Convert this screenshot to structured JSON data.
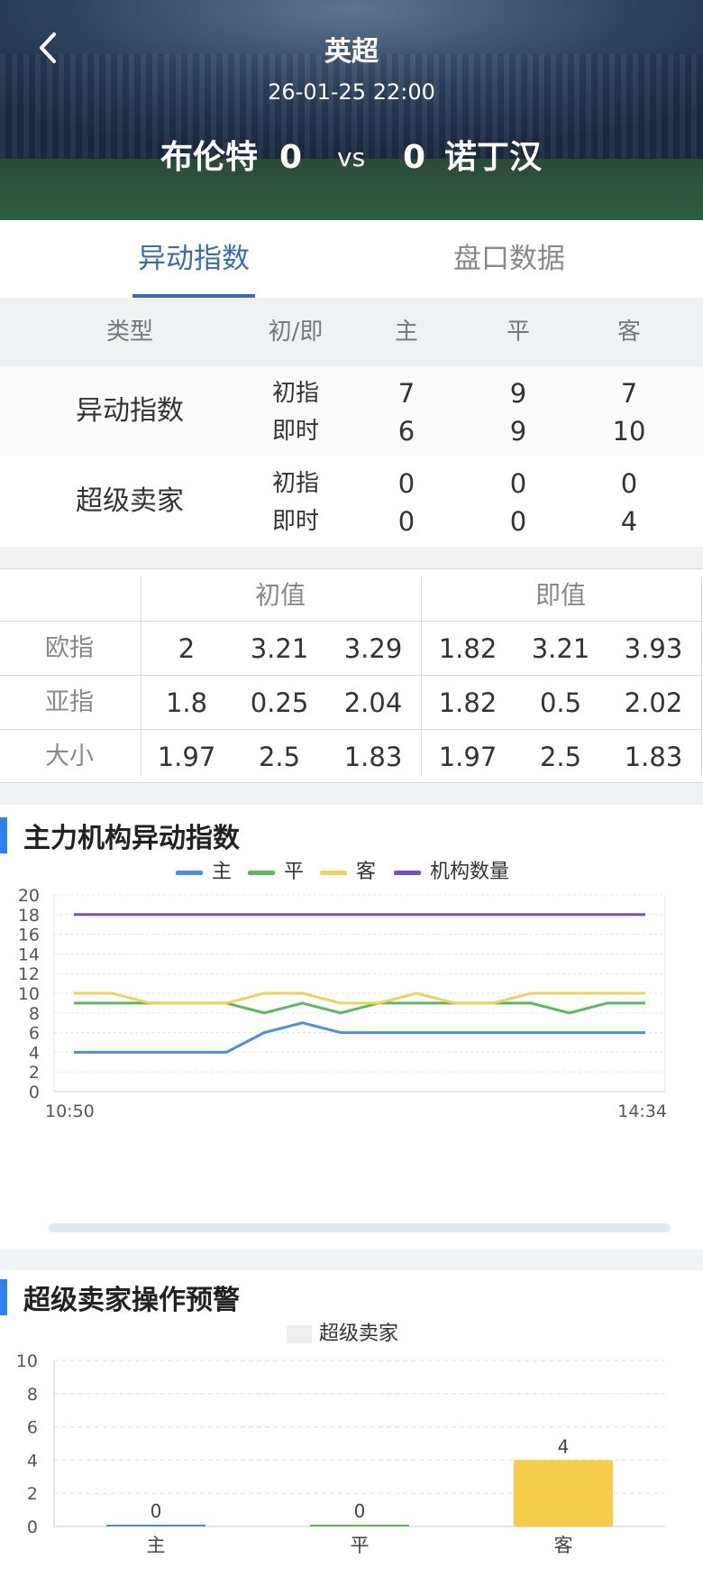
{
  "header": {
    "league": "英超",
    "datetime": "26-01-25 22:00",
    "home_team": "布伦特",
    "home_score": "0",
    "vs": "vs",
    "away_score": "0",
    "away_team": "诺丁汉",
    "back_icon": "chevron-left-icon"
  },
  "tabs": [
    {
      "label": "异动指数",
      "active": true
    },
    {
      "label": "盘口数据",
      "active": false
    }
  ],
  "anomaly_table": {
    "headers": [
      "类型",
      "初/即",
      "主",
      "平",
      "客"
    ],
    "rows": [
      {
        "name": "异动指数",
        "lines": [
          {
            "label": "初指",
            "values": [
              "7",
              "9",
              "7"
            ]
          },
          {
            "label": "即时",
            "values": [
              "6",
              "9",
              "10"
            ]
          }
        ]
      },
      {
        "name": "超级卖家",
        "lines": [
          {
            "label": "初指",
            "values": [
              "0",
              "0",
              "0"
            ]
          },
          {
            "label": "即时",
            "values": [
              "0",
              "0",
              "4"
            ]
          }
        ]
      }
    ]
  },
  "odds_table": {
    "group_headers": [
      "初值",
      "即值"
    ],
    "rows": [
      {
        "label": "欧指",
        "values": [
          "2",
          "3.21",
          "3.29",
          "1.82",
          "3.21",
          "3.93"
        ]
      },
      {
        "label": "亚指",
        "values": [
          "1.8",
          "0.25",
          "2.04",
          "1.82",
          "0.5",
          "2.02"
        ]
      },
      {
        "label": "大小",
        "values": [
          "1.97",
          "2.5",
          "1.83",
          "1.97",
          "2.5",
          "1.83"
        ]
      }
    ]
  },
  "section1": {
    "title": "主力机构异动指数"
  },
  "section2": {
    "title": "超级卖家操作预警"
  },
  "chart_data": [
    {
      "type": "line",
      "title": "主力机构异动指数",
      "ylim": [
        0,
        20
      ],
      "yticks": [
        0,
        2,
        4,
        6,
        8,
        10,
        12,
        14,
        16,
        18,
        20
      ],
      "x_labels": [
        "10:50",
        "14:34"
      ],
      "grid": true,
      "legend_position": "top",
      "series": [
        {
          "name": "主",
          "color": "#4a90d9",
          "values": [
            4,
            4,
            4,
            4,
            4,
            6,
            7,
            6,
            6,
            6,
            6,
            6,
            6,
            6,
            6,
            6
          ]
        },
        {
          "name": "平",
          "color": "#5cb85c",
          "values": [
            9,
            9,
            9,
            9,
            9,
            8,
            9,
            8,
            9,
            9,
            9,
            9,
            9,
            8,
            9,
            9
          ]
        },
        {
          "name": "客",
          "color": "#ecd35a",
          "values": [
            10,
            10,
            9,
            9,
            9,
            10,
            10,
            9,
            9,
            10,
            9,
            9,
            10,
            10,
            10,
            10
          ]
        },
        {
          "name": "机构数量",
          "color": "#7a4fc4",
          "values": [
            18,
            18,
            18,
            18,
            18,
            18,
            18,
            18,
            18,
            18,
            18,
            18,
            18,
            18,
            18,
            18
          ]
        }
      ]
    },
    {
      "type": "bar",
      "title": "超级卖家操作预警",
      "categories": [
        "主",
        "平",
        "客"
      ],
      "series": [
        {
          "name": "超级卖家",
          "values": [
            0,
            0,
            4
          ]
        }
      ],
      "colors": [
        "#4a90d9",
        "#5cb85c",
        "#f5cd4b"
      ],
      "ylim": [
        0,
        10
      ],
      "yticks": [
        0,
        2,
        4,
        6,
        8,
        10
      ],
      "grid": true,
      "legend_position": "top"
    }
  ]
}
